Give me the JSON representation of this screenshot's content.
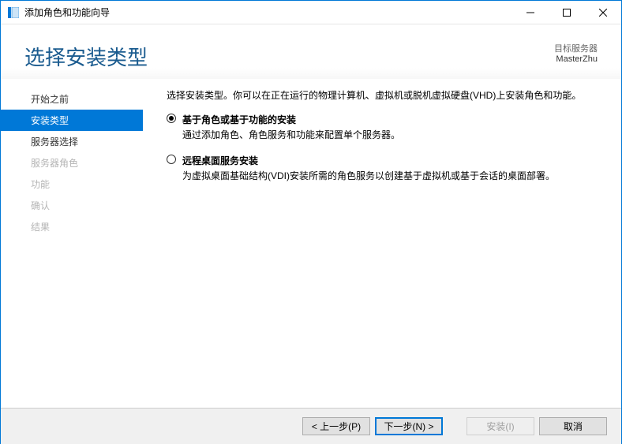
{
  "window": {
    "title": "添加角色和功能向导"
  },
  "header": {
    "heading": "选择安装类型",
    "target_label": "目标服务器",
    "target_name": "MasterZhu"
  },
  "sidebar": {
    "items": [
      {
        "label": "开始之前",
        "state": "enabled"
      },
      {
        "label": "安装类型",
        "state": "selected"
      },
      {
        "label": "服务器选择",
        "state": "enabled"
      },
      {
        "label": "服务器角色",
        "state": "disabled"
      },
      {
        "label": "功能",
        "state": "disabled"
      },
      {
        "label": "确认",
        "state": "disabled"
      },
      {
        "label": "结果",
        "state": "disabled"
      }
    ]
  },
  "content": {
    "description": "选择安装类型。你可以在正在运行的物理计算机、虚拟机或脱机虚拟硬盘(VHD)上安装角色和功能。",
    "options": [
      {
        "title": "基于角色或基于功能的安装",
        "desc": "通过添加角色、角色服务和功能来配置单个服务器。",
        "checked": true
      },
      {
        "title": "远程桌面服务安装",
        "desc": "为虚拟桌面基础结构(VDI)安装所需的角色服务以创建基于虚拟机或基于会话的桌面部署。",
        "checked": false
      }
    ]
  },
  "footer": {
    "prev": "< 上一步(P)",
    "next": "下一步(N) >",
    "install": "安装(I)",
    "cancel": "取消"
  }
}
